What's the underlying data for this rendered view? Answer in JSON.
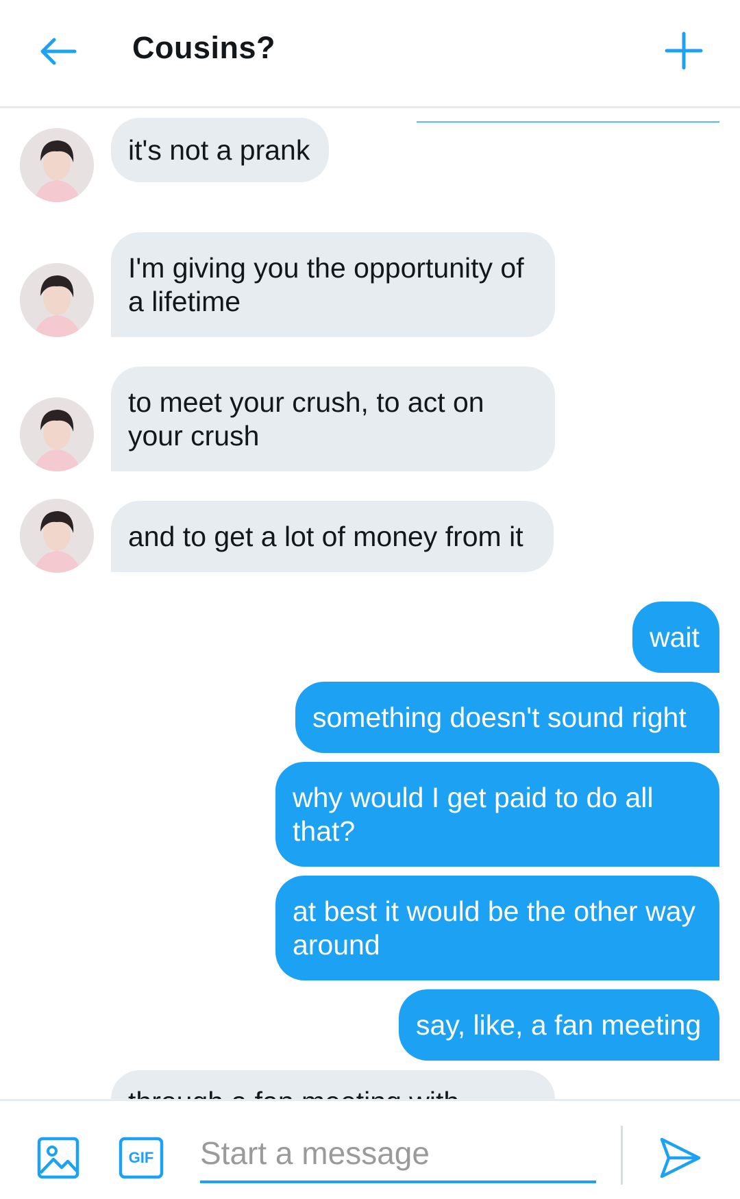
{
  "header": {
    "title": "Cousins?",
    "back_icon": "arrow-left-icon",
    "new_icon": "plus-icon",
    "accent": "#1da1f2"
  },
  "messages": [
    {
      "side": "in",
      "text": "it's not a prank"
    },
    {
      "side": "in",
      "text": "I'm giving you the opportunity of a lifetime"
    },
    {
      "side": "in",
      "text": "to meet your crush, to act on your crush"
    },
    {
      "side": "in",
      "text": "and to get a lot of money from it"
    },
    {
      "side": "out",
      "text": "wait"
    },
    {
      "side": "out",
      "text": "something doesn't sound right"
    },
    {
      "side": "out",
      "text": "why would I get paid to do all that?"
    },
    {
      "side": "out",
      "text": "at best it would be the other way around"
    },
    {
      "side": "out",
      "text": "say, like, a fan meeting"
    },
    {
      "side": "in",
      "text": "through a fan meeting with"
    }
  ],
  "composer": {
    "placeholder": "Start a message",
    "gif_label": "GIF",
    "media_icon": "image-icon",
    "send_icon": "send-icon"
  },
  "colors": {
    "incoming_bubble": "#e6ecf0",
    "outgoing_bubble": "#1da1f2",
    "text": "#14171a"
  }
}
